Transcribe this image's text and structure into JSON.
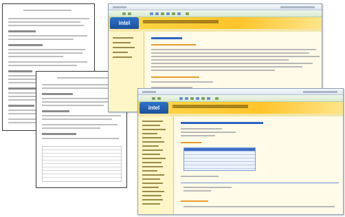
{
  "screens": {
    "app_logo_text": "intel",
    "window_back": {
      "logo": "intel"
    },
    "window_front": {
      "logo": "intel"
    }
  },
  "colors": {
    "banner": "#ffc42a",
    "logo": "#1a4f9a",
    "sidebar": "#fff6c8",
    "heading_link": "#2b62c2",
    "accent_orange": "#e89b2a"
  },
  "icons": [
    "back-icon",
    "forward-icon",
    "refresh-icon",
    "home-icon",
    "search-icon"
  ]
}
